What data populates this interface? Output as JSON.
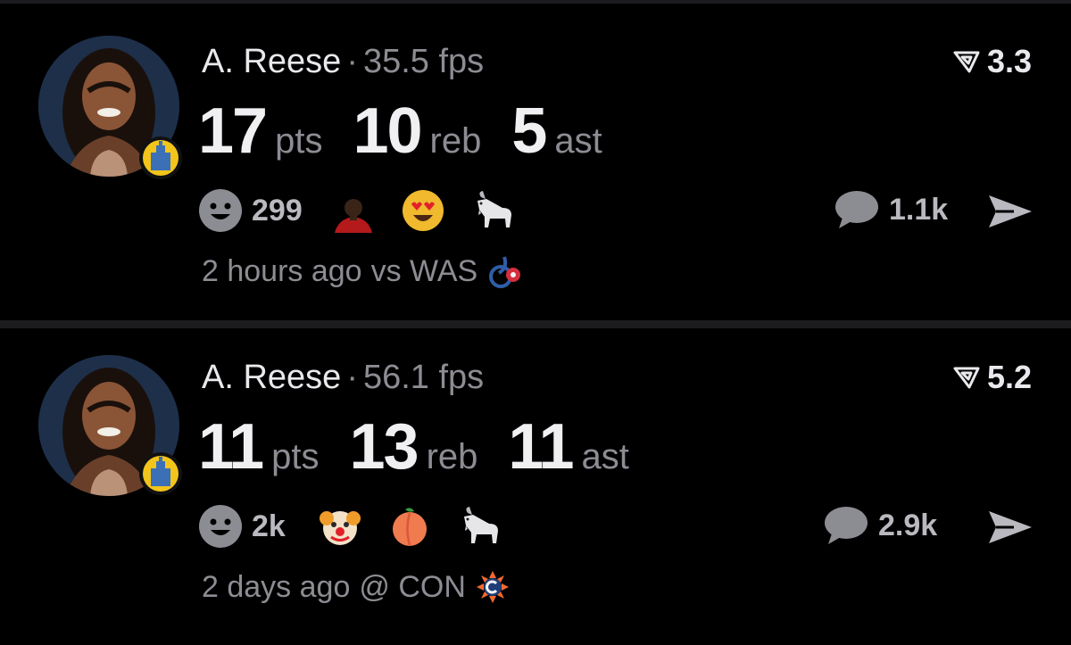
{
  "posts": [
    {
      "player": "A. Reese",
      "fps": "35.5 fps",
      "rating": "3.3",
      "stats": [
        {
          "value": "17",
          "unit": "pts"
        },
        {
          "value": "10",
          "unit": "reb"
        },
        {
          "value": "5",
          "unit": "ast"
        }
      ],
      "reaction_count": "299",
      "reaction_icons": [
        "person-photo-reaction",
        "heart-eyes-emoji",
        "goat-emoji"
      ],
      "comment_count": "1.1k",
      "time": "2 hours ago",
      "opponent": "vs WAS",
      "opponent_logo": "washington-mystics-logo"
    },
    {
      "player": "A. Reese",
      "fps": "56.1 fps",
      "rating": "5.2",
      "stats": [
        {
          "value": "11",
          "unit": "pts"
        },
        {
          "value": "13",
          "unit": "reb"
        },
        {
          "value": "11",
          "unit": "ast"
        }
      ],
      "reaction_count": "2k",
      "reaction_icons": [
        "clown-emoji",
        "peach-emoji",
        "goat-emoji"
      ],
      "comment_count": "2.9k",
      "time": "2 days ago",
      "opponent": "@ CON",
      "opponent_logo": "connecticut-sun-logo"
    }
  ],
  "colors": {
    "background": "#000000",
    "primary_text": "#e9e9ed",
    "secondary_text": "#8c8c93",
    "divider": "#1c1c1f",
    "team_badge": "#f3c51b"
  }
}
